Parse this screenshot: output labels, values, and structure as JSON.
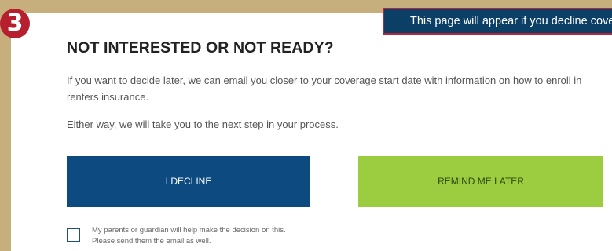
{
  "step": {
    "number": "3"
  },
  "callout": {
    "text": "This page will appear if you decline coverage"
  },
  "content": {
    "title": "NOT INTERESTED OR NOT READY?",
    "description": "If you want to decide later, we can email you closer to your coverage start date with information on how to enroll in renters insurance.",
    "note": "Either way, we will take you to the next step in your process."
  },
  "actions": {
    "decline_label": "I DECLINE",
    "remind_label": "REMIND ME LATER"
  },
  "consent": {
    "checked": false,
    "line1": "My parents or guardian will help make the decision on this.",
    "line2": "Please send them the email as well."
  },
  "colors": {
    "background": "#c7ae7d",
    "step_badge": "#b51f2e",
    "callout_fill": "#0b3f66",
    "callout_border": "#b3263b",
    "decline_button": "#0d4a80",
    "remind_button": "#9ccc3f"
  }
}
